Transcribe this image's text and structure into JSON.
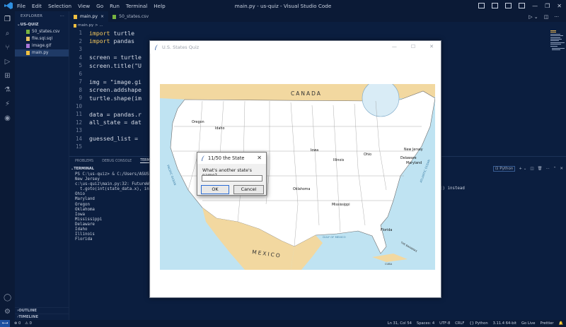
{
  "titlebar": {
    "menus": [
      "File",
      "Edit",
      "Selection",
      "View",
      "Go",
      "Run",
      "Terminal",
      "Help"
    ],
    "title": "main.py - us-quiz - Visual Studio Code"
  },
  "sidebar": {
    "header": "EXPLORER",
    "more": "···",
    "project": "US-QUIZ",
    "files": [
      {
        "name": "50_states.csv",
        "icon": "csv-icon",
        "color": "#78b440"
      },
      {
        "name": "file.sql.sql",
        "icon": "sql-icon",
        "color": "#e8c264"
      },
      {
        "name": "image.gif",
        "icon": "image-icon",
        "color": "#a977d8"
      },
      {
        "name": "main.py",
        "icon": "python-icon",
        "color": "#f0c040"
      }
    ],
    "outline": "OUTLINE",
    "timeline": "TIMELINE"
  },
  "tabs": [
    {
      "label": "main.py",
      "close": "×"
    },
    {
      "label": "50_states.csv",
      "close": ""
    }
  ],
  "breadcrumb": "main.py > ...",
  "code_lines": [
    {
      "n": "1",
      "kw": "import",
      "rest": " turtle"
    },
    {
      "n": "2",
      "kw": "import",
      "rest": " pandas"
    },
    {
      "n": "3",
      "kw": "",
      "rest": ""
    },
    {
      "n": "4",
      "kw": "",
      "rest": "screen = turtle"
    },
    {
      "n": "5",
      "kw": "",
      "rest": "screen.title(\"U"
    },
    {
      "n": "6",
      "kw": "",
      "rest": ""
    },
    {
      "n": "7",
      "kw": "",
      "rest": "img = \"image.gi"
    },
    {
      "n": "8",
      "kw": "",
      "rest": "screen.addshape"
    },
    {
      "n": "9",
      "kw": "",
      "rest": "turtle.shape(im"
    },
    {
      "n": "10",
      "kw": "",
      "rest": ""
    },
    {
      "n": "11",
      "kw": "",
      "rest": "data = pandas.r"
    },
    {
      "n": "12",
      "kw": "",
      "rest": "all_state = dat"
    },
    {
      "n": "13",
      "kw": "",
      "rest": ""
    },
    {
      "n": "14",
      "kw": "",
      "rest": "guessed_list = "
    },
    {
      "n": "15",
      "kw": "",
      "rest": ""
    }
  ],
  "panel": {
    "tabs": [
      "PROBLEMS",
      "DEBUG CONSOLE",
      "TERMINAL"
    ],
    "title": "TERMINAL",
    "python_label": "Python",
    "terminal_lines": [
      "PS C:\\us-quiz> & C:/Users/ASUS",
      "New Jersey",
      "c:\\us-quiz\\main.py:32: FutureW",
      "  t.goto(int(state_data.x), in",
      "Ohio",
      "Maryland",
      "Oregon",
      "Oklahoma",
      "Iowa",
      "Mississippi",
      "Delaware",
      "Idaho",
      "Illinois",
      "Florida"
    ],
    "terminal_tail": "]) instead"
  },
  "turtle_window": {
    "title": "U.S. States Quiz",
    "map_labels": {
      "canada": "CANADA",
      "mexico": "MEXICO",
      "pacific": "PACIFIC OCEAN",
      "atlantic": "ATLANTIC OCEAN",
      "gulf": "GULF OF MEXICO",
      "bahamas": "THE BAHAMAS",
      "cuba": "CUBA"
    },
    "guessed_states": [
      "Oregon",
      "Idaho",
      "Iowa",
      "Illinois",
      "Ohio",
      "New Jersey",
      "Delaware",
      "Maryland",
      "Oklahoma",
      "Mississippi",
      "Florida"
    ]
  },
  "dialog": {
    "title": "11/50 the State",
    "prompt": "What's another state's name?",
    "input_value": "",
    "ok": "OK",
    "cancel": "Cancel"
  },
  "statusbar": {
    "left": [
      "⊗ 0",
      "⚠ 0"
    ],
    "right": [
      "Ln 31, Col 54",
      "Spaces: 4",
      "UTF-8",
      "CRLF",
      "{} Python",
      "3.11.4 64-bit",
      "Go Live",
      "Prettier"
    ]
  },
  "colors": {
    "editor_bg": "#0b1e3f",
    "keyword": "#f7c95c",
    "map_land": "#f2d8a0",
    "map_water": "#bfe3f2"
  }
}
